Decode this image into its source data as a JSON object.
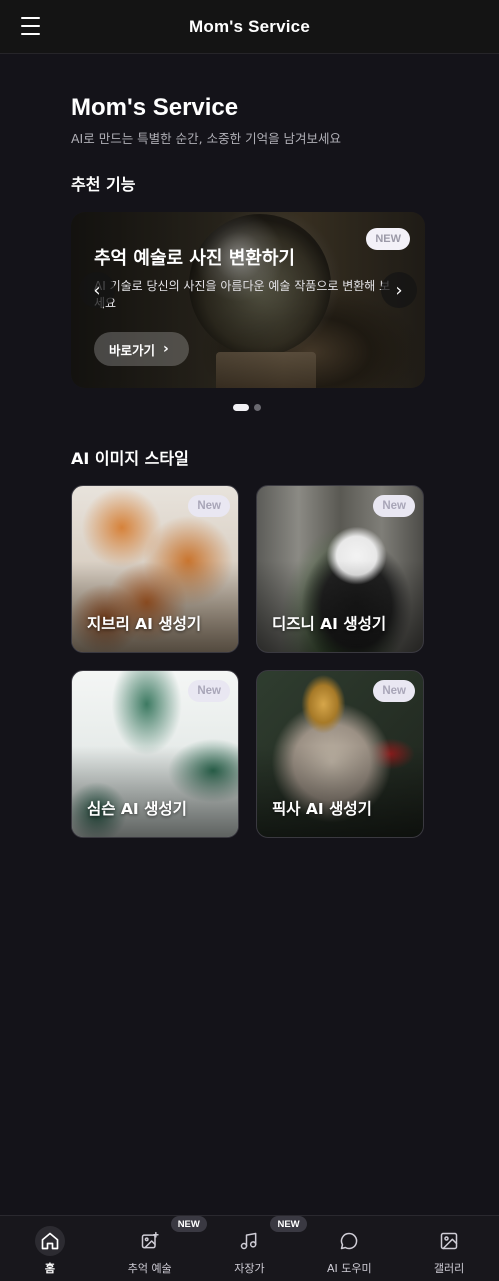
{
  "topbar": {
    "title": "Mom's Service"
  },
  "header": {
    "title": "Mom's Service",
    "subtitle": "AI로 만드는 특별한 순간, 소중한 기억을 남겨보세요"
  },
  "recommended": {
    "section_title": "추천 기능",
    "slide": {
      "title": "추억 예술로 사진 변환하기",
      "description": "AI 기술로 당신의 사진을 아름다운 예술 작품으로 변환해 보세요",
      "button_label": "바로가기",
      "badge": "NEW"
    },
    "prev_icon": "chevron-left-icon",
    "next_icon": "chevron-right-icon",
    "active_slide": 1,
    "slide_count": 2
  },
  "styles": {
    "section_title": "AI 이미지 스타일",
    "cards": [
      {
        "label": "지브리 AI 생성기",
        "badge": "New"
      },
      {
        "label": "디즈니 AI 생성기",
        "badge": "New"
      },
      {
        "label": "심슨 AI 생성기",
        "badge": "New"
      },
      {
        "label": "픽사 AI 생성기",
        "badge": "New"
      }
    ]
  },
  "bottom_nav": {
    "active": 0,
    "items": [
      {
        "label": "홈",
        "icon": "home-icon"
      },
      {
        "label": "추억 예술",
        "icon": "image-plus-icon",
        "badge": "NEW"
      },
      {
        "label": "자장가",
        "icon": "music-note-icon",
        "badge": "NEW"
      },
      {
        "label": "AI 도우미",
        "icon": "chat-bubble-icon"
      },
      {
        "label": "갤러리",
        "icon": "gallery-icon"
      }
    ]
  }
}
